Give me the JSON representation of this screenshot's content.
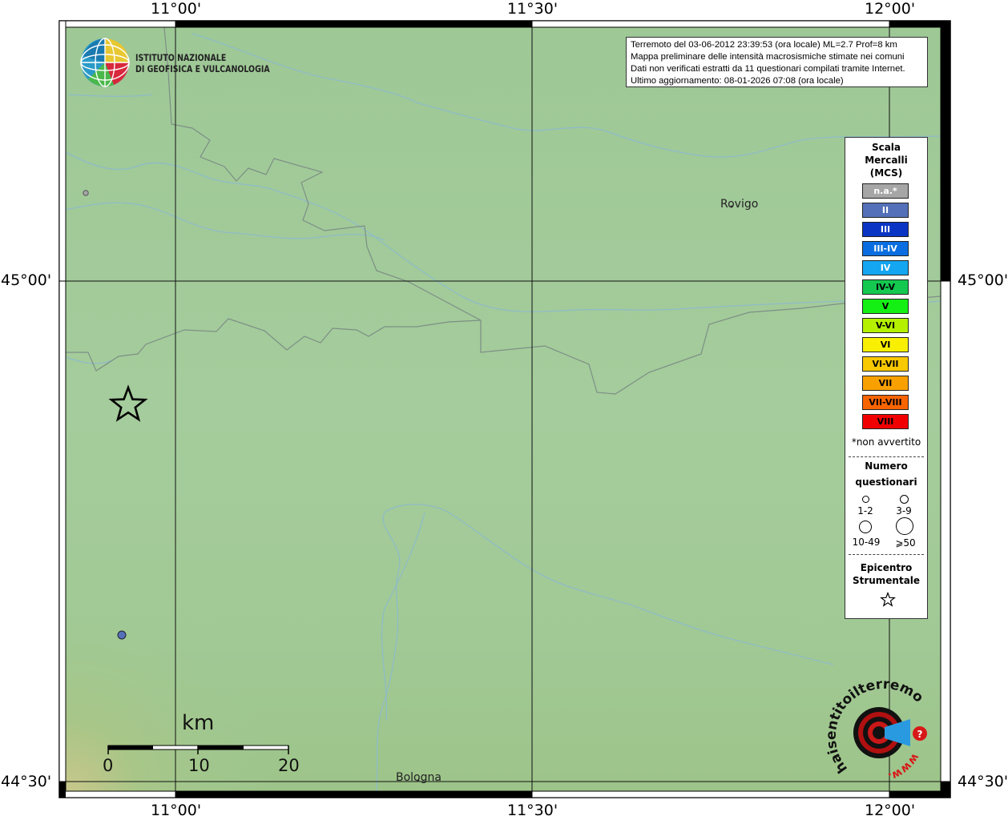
{
  "map": {
    "lon_labels": [
      "11°00'",
      "11°30'",
      "12°00'"
    ],
    "lat_labels": [
      "45°00'",
      "44°30'"
    ],
    "places": [
      {
        "name": "Rovigo"
      },
      {
        "name": "Bologna"
      }
    ]
  },
  "logo": {
    "line1": "ISTITUTO NAZIONALE",
    "line2": "DI GEOFISICA E VULCANOLOGIA"
  },
  "info": {
    "line1": "Terremoto del 03-06-2012 23:39:53 (ora locale) ML=2.7 Prof=8 km",
    "line2": "Mappa preliminare delle intensità macrosismiche stimate nei comuni",
    "line3": "Dati non verificati estratti da 11 questionari compilati tramite Internet.",
    "line4": "Ultimo aggiornamento: 08-01-2026 07:08 (ora locale)"
  },
  "legend": {
    "title_lines": [
      "Scala",
      "Mercalli",
      "(MCS)"
    ],
    "classes": [
      {
        "label": "n.a.*",
        "color": "#a6a6a6",
        "text": "#ffffff"
      },
      {
        "label": "II",
        "color": "#5470b8",
        "text": "#ffffff"
      },
      {
        "label": "III",
        "color": "#0a35c4",
        "text": "#ffffff"
      },
      {
        "label": "III-IV",
        "color": "#0a6ee0",
        "text": "#ffffff"
      },
      {
        "label": "IV",
        "color": "#14a6f0",
        "text": "#ffffff"
      },
      {
        "label": "IV-V",
        "color": "#14c850",
        "text": "#000000"
      },
      {
        "label": "V",
        "color": "#14f014",
        "text": "#000000"
      },
      {
        "label": "V-VI",
        "color": "#b4f000",
        "text": "#000000"
      },
      {
        "label": "VI",
        "color": "#f8f000",
        "text": "#000000"
      },
      {
        "label": "VI-VII",
        "color": "#f8c800",
        "text": "#000000"
      },
      {
        "label": "VII",
        "color": "#f8a000",
        "text": "#000000"
      },
      {
        "label": "VII-VIII",
        "color": "#f86400",
        "text": "#000000"
      },
      {
        "label": "VIII",
        "color": "#f00000",
        "text": "#000000"
      }
    ],
    "na_note": "*non avvertito",
    "count_title_1": "Numero",
    "count_title_2": "questionari",
    "count_labels": [
      "1-2",
      "3-9",
      "10-49",
      "⩾50"
    ],
    "epi_title_1": "Epicentro",
    "epi_title_2": "Strumentale"
  },
  "scalebar": {
    "unit": "km",
    "ticks": [
      "0",
      "10",
      "20"
    ]
  },
  "badge": {
    "text": "haisentitoilterremoto.it",
    "url": "www."
  },
  "observations": [
    {
      "intensity": "na",
      "color": "#a6a6a6",
      "count_class": "1-2"
    },
    {
      "intensity": "II",
      "color": "#5470b8",
      "count_class": "1-2"
    }
  ]
}
